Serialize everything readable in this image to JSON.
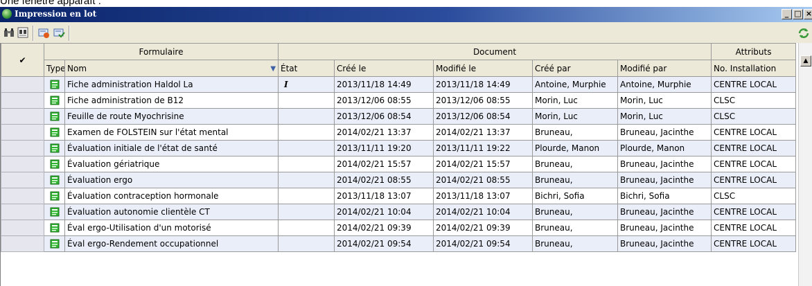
{
  "caption": "Une fenêtre apparaît :",
  "window": {
    "title": "Impression en lot"
  },
  "toolbar": {
    "icons": [
      "binoculars-icon",
      "binoculars-list-icon",
      "print-stop-icon",
      "print-check-icon"
    ]
  },
  "table": {
    "groups": {
      "form": "Formulaire",
      "document": "Document",
      "attributes": "Attributs"
    },
    "columns": {
      "type": "Type",
      "name": "Nom",
      "state": "État",
      "created": "Créé le",
      "modified": "Modifié le",
      "created_by": "Créé par",
      "modified_by": "Modifié par",
      "installation": "No. Installation"
    },
    "rows": [
      {
        "name": "Fiche administration Haldol La",
        "state": "I",
        "created": "2013/11/18 14:49",
        "modified": "2013/11/18 14:49",
        "created_by": "Antoine, Murphie",
        "modified_by": "Antoine, Murphie",
        "installation": "CENTRE LOCAL"
      },
      {
        "name": "Fiche administration de B12",
        "state": "",
        "created": "2013/12/06 08:55",
        "modified": "2013/12/06 08:55",
        "created_by": "Morin, Luc",
        "modified_by": "Morin, Luc",
        "installation": "CLSC"
      },
      {
        "name": "Feuille de route Myochrisine",
        "state": "",
        "created": "2013/12/06 08:54",
        "modified": "2013/12/06 08:54",
        "created_by": "Morin, Luc",
        "modified_by": "Morin, Luc",
        "installation": "CLSC"
      },
      {
        "name": "Examen de FOLSTEIN sur l'état mental",
        "state": "",
        "created": "2014/02/21 13:37",
        "modified": "2014/02/21 13:37",
        "created_by": "Bruneau,",
        "modified_by": "Bruneau, Jacinthe",
        "installation": "CENTRE LOCAL"
      },
      {
        "name": "Évaluation initiale de l'état de santé",
        "state": "",
        "created": "2013/11/11 19:20",
        "modified": "2013/11/11 19:22",
        "created_by": "Plourde, Manon",
        "modified_by": "Plourde, Manon",
        "installation": "CENTRE LOCAL"
      },
      {
        "name": "Évaluation gériatrique",
        "state": "",
        "created": "2014/02/21 15:57",
        "modified": "2014/02/21 15:57",
        "created_by": "Bruneau,",
        "modified_by": "Bruneau, Jacinthe",
        "installation": "CENTRE LOCAL"
      },
      {
        "name": "Évaluation ergo",
        "state": "",
        "created": "2014/02/21 08:55",
        "modified": "2014/02/21 08:55",
        "created_by": "Bruneau,",
        "modified_by": "Bruneau, Jacinthe",
        "installation": "CENTRE LOCAL"
      },
      {
        "name": "Évaluation contraception hormonale",
        "state": "",
        "created": "2013/11/18 13:07",
        "modified": "2013/11/18 13:07",
        "created_by": "Bichri, Sofia",
        "modified_by": "Bichri, Sofia",
        "installation": "CLSC"
      },
      {
        "name": "Évaluation autonomie clientèle CT",
        "state": "",
        "created": "2014/02/21 10:04",
        "modified": "2014/02/21 10:04",
        "created_by": "Bruneau,",
        "modified_by": "Bruneau, Jacinthe",
        "installation": "CENTRE LOCAL"
      },
      {
        "name": "Éval ergo-Utilisation d'un motorisé",
        "state": "",
        "created": "2014/02/21 09:39",
        "modified": "2014/02/21 09:39",
        "created_by": "Bruneau,",
        "modified_by": "Bruneau, Jacinthe",
        "installation": "CENTRE LOCAL"
      },
      {
        "name": "Éval ergo-Rendement occupationnel",
        "state": "",
        "created": "2014/02/21 09:54",
        "modified": "2014/02/21 09:54",
        "created_by": "Bruneau,",
        "modified_by": "Bruneau, Jacinthe",
        "installation": "CENTRE LOCAL"
      }
    ]
  }
}
